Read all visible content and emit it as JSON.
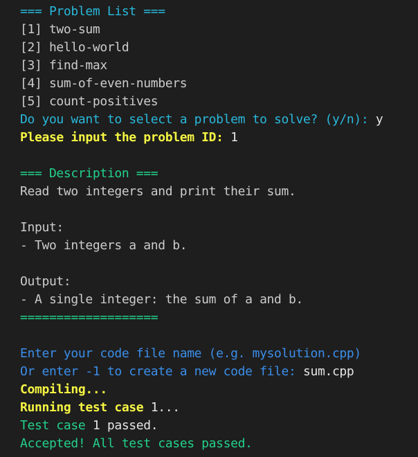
{
  "terminal": {
    "problem_list_header": "=== Problem List ===",
    "problems": [
      "[1] two-sum",
      "[2] hello-world",
      "[3] find-max",
      "[4] sum-of-even-numbers",
      "[5] count-positives"
    ],
    "select_prompt": "Do you want to select a problem to solve? (y/n): ",
    "select_answer": "y",
    "id_prompt": "Please input the problem ID: ",
    "id_answer": "1",
    "description_header": "=== Description ===",
    "description_text": "Read two integers and print their sum.",
    "input_label": "Input:",
    "input_text": "- Two integers a and b.",
    "output_label": "Output:",
    "output_text": "- A single integer: the sum of a and b.",
    "description_footer": "===================",
    "code_file_prompt": "Enter your code file name (e.g. mysolution.cpp)",
    "create_prompt": "Or enter -1 to create a new code file: ",
    "create_answer": "sum.cpp",
    "compiling": "Compiling...",
    "running_prefix": "Running test case ",
    "running_suffix": "1...",
    "test_case_prefix": "Test case ",
    "test_case_suffix": "1 passed.",
    "accepted": "Accepted! All test cases passed."
  }
}
